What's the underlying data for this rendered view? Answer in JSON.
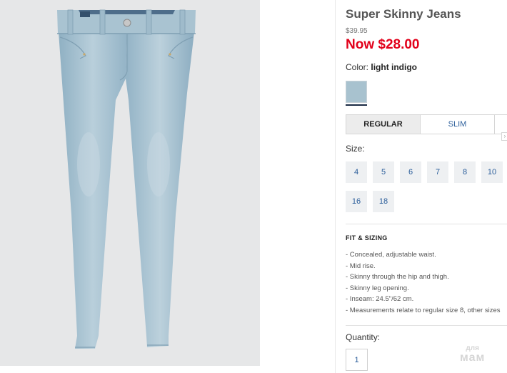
{
  "product": {
    "title": "Super Skinny Jeans",
    "original_price": "$39.95",
    "sale_price": "Now $28.00",
    "image_icon": "jeans-image",
    "color": {
      "label": "Color:",
      "value": "light indigo",
      "swatch_hex": "#a8c2cf"
    },
    "fit_tabs": [
      {
        "label": "REGULAR",
        "active": true
      },
      {
        "label": "SLIM",
        "active": false
      }
    ],
    "size_label": "Size:",
    "sizes": [
      "4",
      "5",
      "6",
      "7",
      "8",
      "10",
      "16",
      "18"
    ],
    "fit_sizing": {
      "heading": "FIT & SIZING",
      "items": [
        "- Concealed, adjustable waist.",
        "- Mid rise.",
        "- Skinny through the hip and thigh.",
        "- Skinny leg opening.",
        "- Inseam: 24.5\"/62 cm.",
        "- Measurements relate to regular size 8, other sizes"
      ]
    },
    "quantity": {
      "label": "Quantity:",
      "value": "1"
    }
  },
  "watermark": {
    "line1": "для",
    "line2": "мам"
  },
  "colors": {
    "sale_red": "#e2001a",
    "link_blue": "#2a5d9a",
    "denim": "#a8c2cf"
  }
}
